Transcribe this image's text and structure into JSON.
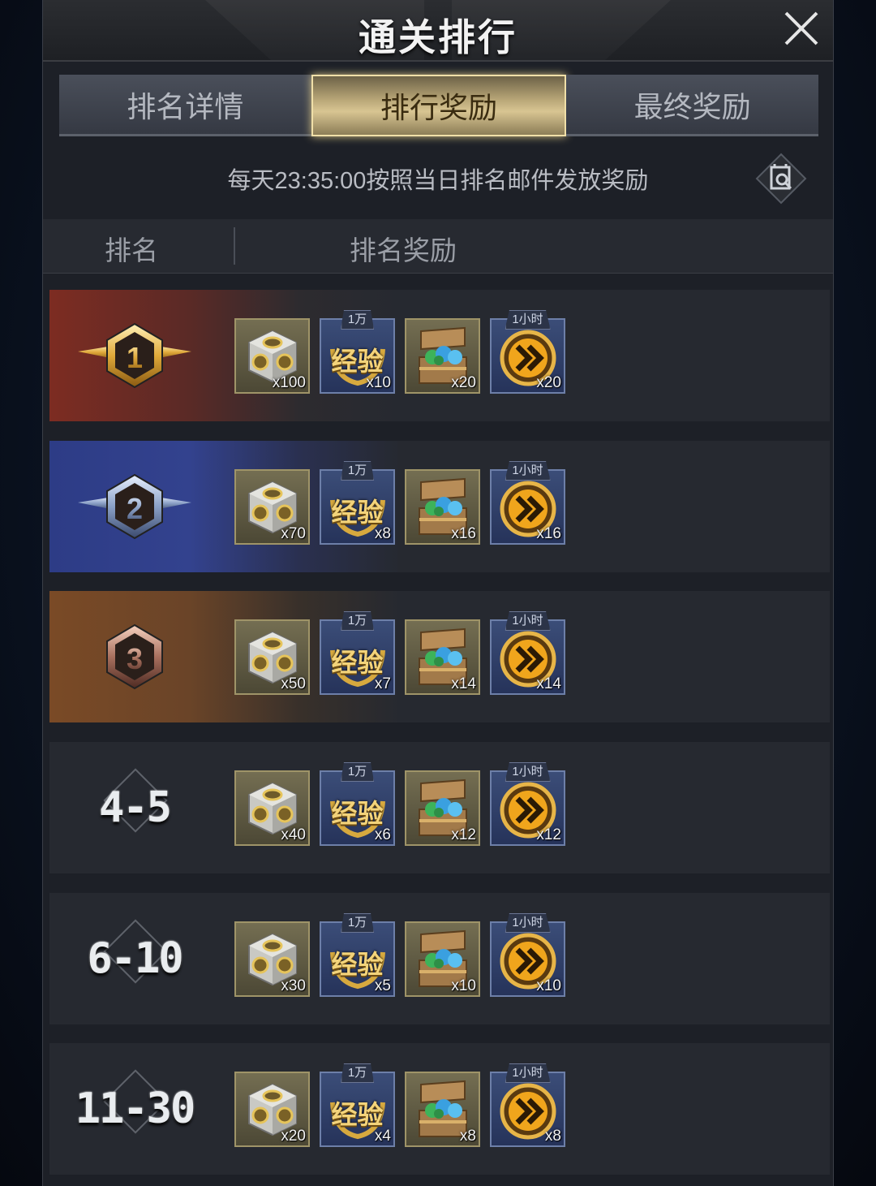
{
  "header": {
    "title": "通关排行"
  },
  "tabs": [
    {
      "label": "排名详情",
      "active": false
    },
    {
      "label": "排行奖励",
      "active": true
    },
    {
      "label": "最终奖励",
      "active": false
    }
  ],
  "notice": "每天23:35:00按照当日排名邮件发放奖励",
  "columns": {
    "rank": "排名",
    "reward": "排名奖励"
  },
  "item_tags": {
    "xp": "1万",
    "speed": "1小时"
  },
  "xp_label": "经验",
  "rows": [
    {
      "rank": "1",
      "badge": "gold-wing-badge",
      "qty": [
        "x100",
        "x10",
        "x20",
        "x20"
      ]
    },
    {
      "rank": "2",
      "badge": "silver-wing-badge",
      "qty": [
        "x70",
        "x8",
        "x16",
        "x16"
      ]
    },
    {
      "rank": "3",
      "badge": "bronze-badge",
      "qty": [
        "x50",
        "x7",
        "x14",
        "x14"
      ]
    },
    {
      "rank": "4-5",
      "qty": [
        "x40",
        "x6",
        "x12",
        "x12"
      ]
    },
    {
      "rank": "6-10",
      "qty": [
        "x30",
        "x5",
        "x10",
        "x10"
      ]
    },
    {
      "rank": "11-30",
      "qty": [
        "x20",
        "x4",
        "x8",
        "x8"
      ]
    }
  ],
  "colors": {
    "gold_accent": "#d8c592",
    "row1": "#7d2c22",
    "row2": "#2d3c86",
    "row3": "#7a4a26"
  }
}
